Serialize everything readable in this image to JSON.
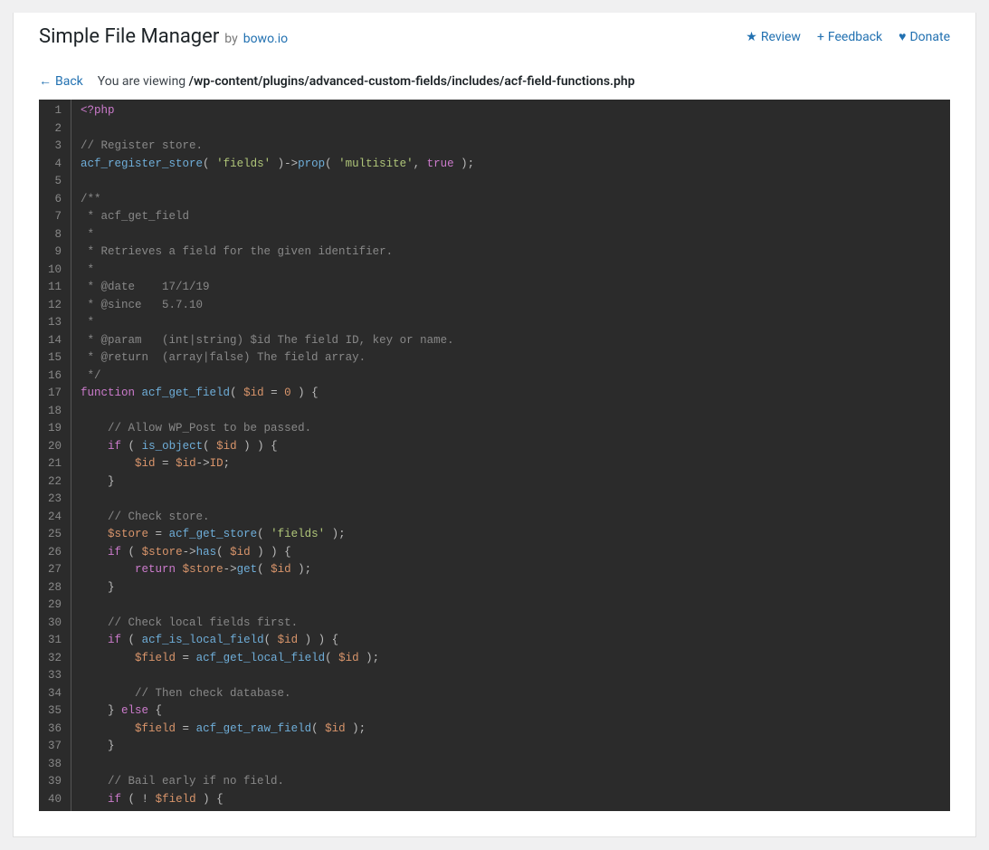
{
  "header": {
    "title": "Simple File Manager",
    "by": "by",
    "author": "bowo.io",
    "links": {
      "review": "Review",
      "feedback": "Feedback",
      "donate": "Donate"
    },
    "icons": {
      "star": "★",
      "plus": "+",
      "heart": "♥",
      "arrow_left": "←"
    }
  },
  "nav": {
    "back": "Back",
    "viewing_label": "You are viewing",
    "path": "/wp-content/plugins/advanced-custom-fields/includes/acf-field-functions.php"
  },
  "code": {
    "line_count": 40,
    "lines": [
      {
        "n": 1,
        "tokens": [
          {
            "c": "tok-tag",
            "t": "<?php"
          }
        ]
      },
      {
        "n": 2,
        "tokens": []
      },
      {
        "n": 3,
        "tokens": [
          {
            "c": "tok-comment",
            "t": "// Register store."
          }
        ]
      },
      {
        "n": 4,
        "tokens": [
          {
            "c": "tok-func",
            "t": "acf_register_store"
          },
          {
            "c": "tok-punct",
            "t": "( "
          },
          {
            "c": "tok-str",
            "t": "'fields'"
          },
          {
            "c": "tok-punct",
            "t": " )->"
          },
          {
            "c": "tok-meth",
            "t": "prop"
          },
          {
            "c": "tok-punct",
            "t": "( "
          },
          {
            "c": "tok-str",
            "t": "'multisite'"
          },
          {
            "c": "tok-punct",
            "t": ", "
          },
          {
            "c": "tok-kw",
            "t": "true"
          },
          {
            "c": "tok-punct",
            "t": " );"
          }
        ]
      },
      {
        "n": 5,
        "tokens": []
      },
      {
        "n": 6,
        "tokens": [
          {
            "c": "tok-comment",
            "t": "/**"
          }
        ]
      },
      {
        "n": 7,
        "tokens": [
          {
            "c": "tok-comment",
            "t": " * acf_get_field"
          }
        ]
      },
      {
        "n": 8,
        "tokens": [
          {
            "c": "tok-comment",
            "t": " *"
          }
        ]
      },
      {
        "n": 9,
        "tokens": [
          {
            "c": "tok-comment",
            "t": " * Retrieves a field for the given identifier."
          }
        ]
      },
      {
        "n": 10,
        "tokens": [
          {
            "c": "tok-comment",
            "t": " *"
          }
        ]
      },
      {
        "n": 11,
        "tokens": [
          {
            "c": "tok-comment",
            "t": " * @date    17/1/19"
          }
        ]
      },
      {
        "n": 12,
        "tokens": [
          {
            "c": "tok-comment",
            "t": " * @since   5.7.10"
          }
        ]
      },
      {
        "n": 13,
        "tokens": [
          {
            "c": "tok-comment",
            "t": " *"
          }
        ]
      },
      {
        "n": 14,
        "tokens": [
          {
            "c": "tok-comment",
            "t": " * @param   (int|string) $id The field ID, key or name."
          }
        ]
      },
      {
        "n": 15,
        "tokens": [
          {
            "c": "tok-comment",
            "t": " * @return  (array|false) The field array."
          }
        ]
      },
      {
        "n": 16,
        "tokens": [
          {
            "c": "tok-comment",
            "t": " */"
          }
        ]
      },
      {
        "n": 17,
        "tokens": [
          {
            "c": "tok-kw",
            "t": "function"
          },
          {
            "c": "tok-punct",
            "t": " "
          },
          {
            "c": "tok-func",
            "t": "acf_get_field"
          },
          {
            "c": "tok-punct",
            "t": "( "
          },
          {
            "c": "tok-var",
            "t": "$id"
          },
          {
            "c": "tok-punct",
            "t": " = "
          },
          {
            "c": "tok-num",
            "t": "0"
          },
          {
            "c": "tok-punct",
            "t": " ) {"
          }
        ]
      },
      {
        "n": 18,
        "tokens": []
      },
      {
        "n": 19,
        "tokens": [
          {
            "c": "tok-punct",
            "t": "    "
          },
          {
            "c": "tok-comment",
            "t": "// Allow WP_Post to be passed."
          }
        ]
      },
      {
        "n": 20,
        "tokens": [
          {
            "c": "tok-punct",
            "t": "    "
          },
          {
            "c": "tok-kw",
            "t": "if"
          },
          {
            "c": "tok-punct",
            "t": " ( "
          },
          {
            "c": "tok-func",
            "t": "is_object"
          },
          {
            "c": "tok-punct",
            "t": "( "
          },
          {
            "c": "tok-var",
            "t": "$id"
          },
          {
            "c": "tok-punct",
            "t": " ) ) {"
          }
        ]
      },
      {
        "n": 21,
        "tokens": [
          {
            "c": "tok-punct",
            "t": "        "
          },
          {
            "c": "tok-var",
            "t": "$id"
          },
          {
            "c": "tok-punct",
            "t": " = "
          },
          {
            "c": "tok-var",
            "t": "$id"
          },
          {
            "c": "tok-punct",
            "t": "->"
          },
          {
            "c": "tok-kw2",
            "t": "ID"
          },
          {
            "c": "tok-punct",
            "t": ";"
          }
        ]
      },
      {
        "n": 22,
        "tokens": [
          {
            "c": "tok-punct",
            "t": "    }"
          }
        ]
      },
      {
        "n": 23,
        "tokens": []
      },
      {
        "n": 24,
        "tokens": [
          {
            "c": "tok-punct",
            "t": "    "
          },
          {
            "c": "tok-comment",
            "t": "// Check store."
          }
        ]
      },
      {
        "n": 25,
        "tokens": [
          {
            "c": "tok-punct",
            "t": "    "
          },
          {
            "c": "tok-var",
            "t": "$store"
          },
          {
            "c": "tok-punct",
            "t": " = "
          },
          {
            "c": "tok-func",
            "t": "acf_get_store"
          },
          {
            "c": "tok-punct",
            "t": "( "
          },
          {
            "c": "tok-str",
            "t": "'fields'"
          },
          {
            "c": "tok-punct",
            "t": " );"
          }
        ]
      },
      {
        "n": 26,
        "tokens": [
          {
            "c": "tok-punct",
            "t": "    "
          },
          {
            "c": "tok-kw",
            "t": "if"
          },
          {
            "c": "tok-punct",
            "t": " ( "
          },
          {
            "c": "tok-var",
            "t": "$store"
          },
          {
            "c": "tok-punct",
            "t": "->"
          },
          {
            "c": "tok-meth",
            "t": "has"
          },
          {
            "c": "tok-punct",
            "t": "( "
          },
          {
            "c": "tok-var",
            "t": "$id"
          },
          {
            "c": "tok-punct",
            "t": " ) ) {"
          }
        ]
      },
      {
        "n": 27,
        "tokens": [
          {
            "c": "tok-punct",
            "t": "        "
          },
          {
            "c": "tok-kw",
            "t": "return"
          },
          {
            "c": "tok-punct",
            "t": " "
          },
          {
            "c": "tok-var",
            "t": "$store"
          },
          {
            "c": "tok-punct",
            "t": "->"
          },
          {
            "c": "tok-meth",
            "t": "get"
          },
          {
            "c": "tok-punct",
            "t": "( "
          },
          {
            "c": "tok-var",
            "t": "$id"
          },
          {
            "c": "tok-punct",
            "t": " );"
          }
        ]
      },
      {
        "n": 28,
        "tokens": [
          {
            "c": "tok-punct",
            "t": "    }"
          }
        ]
      },
      {
        "n": 29,
        "tokens": []
      },
      {
        "n": 30,
        "tokens": [
          {
            "c": "tok-punct",
            "t": "    "
          },
          {
            "c": "tok-comment",
            "t": "// Check local fields first."
          }
        ]
      },
      {
        "n": 31,
        "tokens": [
          {
            "c": "tok-punct",
            "t": "    "
          },
          {
            "c": "tok-kw",
            "t": "if"
          },
          {
            "c": "tok-punct",
            "t": " ( "
          },
          {
            "c": "tok-func",
            "t": "acf_is_local_field"
          },
          {
            "c": "tok-punct",
            "t": "( "
          },
          {
            "c": "tok-var",
            "t": "$id"
          },
          {
            "c": "tok-punct",
            "t": " ) ) {"
          }
        ]
      },
      {
        "n": 32,
        "tokens": [
          {
            "c": "tok-punct",
            "t": "        "
          },
          {
            "c": "tok-var",
            "t": "$field"
          },
          {
            "c": "tok-punct",
            "t": " = "
          },
          {
            "c": "tok-func",
            "t": "acf_get_local_field"
          },
          {
            "c": "tok-punct",
            "t": "( "
          },
          {
            "c": "tok-var",
            "t": "$id"
          },
          {
            "c": "tok-punct",
            "t": " );"
          }
        ]
      },
      {
        "n": 33,
        "tokens": []
      },
      {
        "n": 34,
        "tokens": [
          {
            "c": "tok-punct",
            "t": "        "
          },
          {
            "c": "tok-comment",
            "t": "// Then check database."
          }
        ]
      },
      {
        "n": 35,
        "tokens": [
          {
            "c": "tok-punct",
            "t": "    } "
          },
          {
            "c": "tok-kw",
            "t": "else"
          },
          {
            "c": "tok-punct",
            "t": " {"
          }
        ]
      },
      {
        "n": 36,
        "tokens": [
          {
            "c": "tok-punct",
            "t": "        "
          },
          {
            "c": "tok-var",
            "t": "$field"
          },
          {
            "c": "tok-punct",
            "t": " = "
          },
          {
            "c": "tok-func",
            "t": "acf_get_raw_field"
          },
          {
            "c": "tok-punct",
            "t": "( "
          },
          {
            "c": "tok-var",
            "t": "$id"
          },
          {
            "c": "tok-punct",
            "t": " );"
          }
        ]
      },
      {
        "n": 37,
        "tokens": [
          {
            "c": "tok-punct",
            "t": "    }"
          }
        ]
      },
      {
        "n": 38,
        "tokens": []
      },
      {
        "n": 39,
        "tokens": [
          {
            "c": "tok-punct",
            "t": "    "
          },
          {
            "c": "tok-comment",
            "t": "// Bail early if no field."
          }
        ]
      },
      {
        "n": 40,
        "tokens": [
          {
            "c": "tok-punct",
            "t": "    "
          },
          {
            "c": "tok-kw",
            "t": "if"
          },
          {
            "c": "tok-punct",
            "t": " ( ! "
          },
          {
            "c": "tok-var",
            "t": "$field"
          },
          {
            "c": "tok-punct",
            "t": " ) {"
          }
        ]
      }
    ]
  }
}
